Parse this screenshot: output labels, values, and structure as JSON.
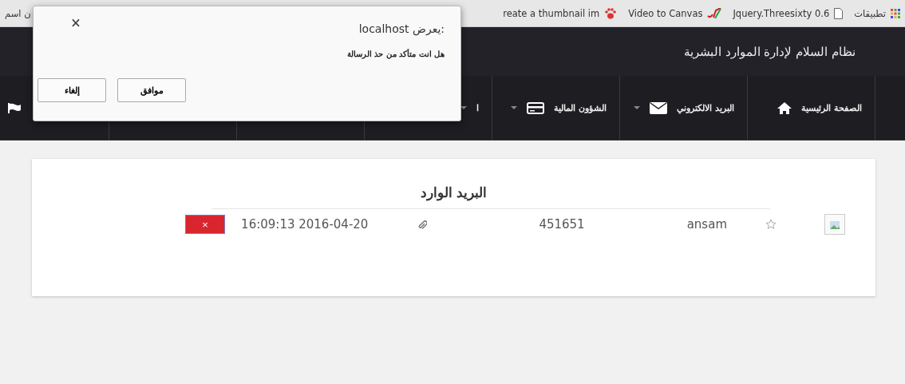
{
  "bookmarks_bar": {
    "items": [
      {
        "label": "تطبيقات",
        "kind": "apps"
      },
      {
        "label": "Jquery.Threesixty 0.6",
        "kind": "page"
      },
      {
        "label": "Video to Canvas",
        "kind": "sl"
      },
      {
        "label": "reate a thumbnail im",
        "kind": "paw"
      },
      {
        "label": "ن اسم",
        "kind": "plain"
      }
    ]
  },
  "header": {
    "title": "نظام السلام لإدارة الموارد البشرية"
  },
  "nav": {
    "items": [
      {
        "label": "الصفحة الرئيسية",
        "kind": "home",
        "dropdown": false
      },
      {
        "label": "البريد الالكتروني",
        "kind": "envelope",
        "dropdown": true
      },
      {
        "label": "الشؤون المالية",
        "kind": "card",
        "dropdown": true
      },
      {
        "label": "ا",
        "kind": "text",
        "dropdown": true
      }
    ]
  },
  "inbox": {
    "title": "البريد الوارد",
    "rows": [
      {
        "sender": "ansam",
        "starred": false,
        "number": "451651",
        "has_attachment": true,
        "date": "16:09:13 2016-04-20",
        "delete": "×"
      }
    ]
  },
  "dialog": {
    "title": ":يعرض localhost",
    "message": "هل انت متأكد من حذ الرسالة",
    "close": "×",
    "buttons": [
      {
        "label": "موافق"
      },
      {
        "label": "إلغاء"
      }
    ]
  }
}
